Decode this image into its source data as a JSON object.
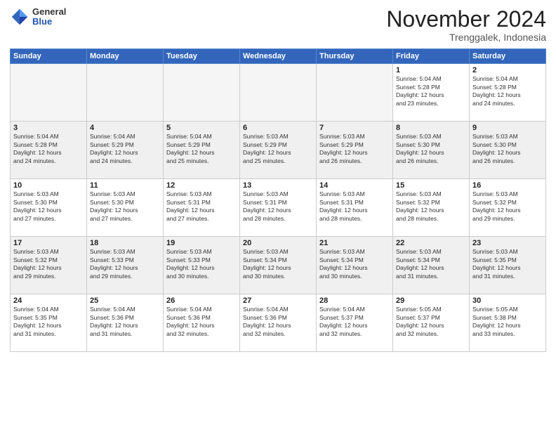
{
  "logo": {
    "general": "General",
    "blue": "Blue"
  },
  "header": {
    "month": "November 2024",
    "location": "Trenggalek, Indonesia"
  },
  "weekdays": [
    "Sunday",
    "Monday",
    "Tuesday",
    "Wednesday",
    "Thursday",
    "Friday",
    "Saturday"
  ],
  "weeks": [
    [
      {
        "day": "",
        "info": ""
      },
      {
        "day": "",
        "info": ""
      },
      {
        "day": "",
        "info": ""
      },
      {
        "day": "",
        "info": ""
      },
      {
        "day": "",
        "info": ""
      },
      {
        "day": "1",
        "info": "Sunrise: 5:04 AM\nSunset: 5:28 PM\nDaylight: 12 hours\nand 23 minutes."
      },
      {
        "day": "2",
        "info": "Sunrise: 5:04 AM\nSunset: 5:28 PM\nDaylight: 12 hours\nand 24 minutes."
      }
    ],
    [
      {
        "day": "3",
        "info": "Sunrise: 5:04 AM\nSunset: 5:28 PM\nDaylight: 12 hours\nand 24 minutes."
      },
      {
        "day": "4",
        "info": "Sunrise: 5:04 AM\nSunset: 5:29 PM\nDaylight: 12 hours\nand 24 minutes."
      },
      {
        "day": "5",
        "info": "Sunrise: 5:04 AM\nSunset: 5:29 PM\nDaylight: 12 hours\nand 25 minutes."
      },
      {
        "day": "6",
        "info": "Sunrise: 5:03 AM\nSunset: 5:29 PM\nDaylight: 12 hours\nand 25 minutes."
      },
      {
        "day": "7",
        "info": "Sunrise: 5:03 AM\nSunset: 5:29 PM\nDaylight: 12 hours\nand 26 minutes."
      },
      {
        "day": "8",
        "info": "Sunrise: 5:03 AM\nSunset: 5:30 PM\nDaylight: 12 hours\nand 26 minutes."
      },
      {
        "day": "9",
        "info": "Sunrise: 5:03 AM\nSunset: 5:30 PM\nDaylight: 12 hours\nand 26 minutes."
      }
    ],
    [
      {
        "day": "10",
        "info": "Sunrise: 5:03 AM\nSunset: 5:30 PM\nDaylight: 12 hours\nand 27 minutes."
      },
      {
        "day": "11",
        "info": "Sunrise: 5:03 AM\nSunset: 5:30 PM\nDaylight: 12 hours\nand 27 minutes."
      },
      {
        "day": "12",
        "info": "Sunrise: 5:03 AM\nSunset: 5:31 PM\nDaylight: 12 hours\nand 27 minutes."
      },
      {
        "day": "13",
        "info": "Sunrise: 5:03 AM\nSunset: 5:31 PM\nDaylight: 12 hours\nand 28 minutes."
      },
      {
        "day": "14",
        "info": "Sunrise: 5:03 AM\nSunset: 5:31 PM\nDaylight: 12 hours\nand 28 minutes."
      },
      {
        "day": "15",
        "info": "Sunrise: 5:03 AM\nSunset: 5:32 PM\nDaylight: 12 hours\nand 28 minutes."
      },
      {
        "day": "16",
        "info": "Sunrise: 5:03 AM\nSunset: 5:32 PM\nDaylight: 12 hours\nand 29 minutes."
      }
    ],
    [
      {
        "day": "17",
        "info": "Sunrise: 5:03 AM\nSunset: 5:32 PM\nDaylight: 12 hours\nand 29 minutes."
      },
      {
        "day": "18",
        "info": "Sunrise: 5:03 AM\nSunset: 5:33 PM\nDaylight: 12 hours\nand 29 minutes."
      },
      {
        "day": "19",
        "info": "Sunrise: 5:03 AM\nSunset: 5:33 PM\nDaylight: 12 hours\nand 30 minutes."
      },
      {
        "day": "20",
        "info": "Sunrise: 5:03 AM\nSunset: 5:34 PM\nDaylight: 12 hours\nand 30 minutes."
      },
      {
        "day": "21",
        "info": "Sunrise: 5:03 AM\nSunset: 5:34 PM\nDaylight: 12 hours\nand 30 minutes."
      },
      {
        "day": "22",
        "info": "Sunrise: 5:03 AM\nSunset: 5:34 PM\nDaylight: 12 hours\nand 31 minutes."
      },
      {
        "day": "23",
        "info": "Sunrise: 5:03 AM\nSunset: 5:35 PM\nDaylight: 12 hours\nand 31 minutes."
      }
    ],
    [
      {
        "day": "24",
        "info": "Sunrise: 5:04 AM\nSunset: 5:35 PM\nDaylight: 12 hours\nand 31 minutes."
      },
      {
        "day": "25",
        "info": "Sunrise: 5:04 AM\nSunset: 5:36 PM\nDaylight: 12 hours\nand 31 minutes."
      },
      {
        "day": "26",
        "info": "Sunrise: 5:04 AM\nSunset: 5:36 PM\nDaylight: 12 hours\nand 32 minutes."
      },
      {
        "day": "27",
        "info": "Sunrise: 5:04 AM\nSunset: 5:36 PM\nDaylight: 12 hours\nand 32 minutes."
      },
      {
        "day": "28",
        "info": "Sunrise: 5:04 AM\nSunset: 5:37 PM\nDaylight: 12 hours\nand 32 minutes."
      },
      {
        "day": "29",
        "info": "Sunrise: 5:05 AM\nSunset: 5:37 PM\nDaylight: 12 hours\nand 32 minutes."
      },
      {
        "day": "30",
        "info": "Sunrise: 5:05 AM\nSunset: 5:38 PM\nDaylight: 12 hours\nand 33 minutes."
      }
    ]
  ]
}
